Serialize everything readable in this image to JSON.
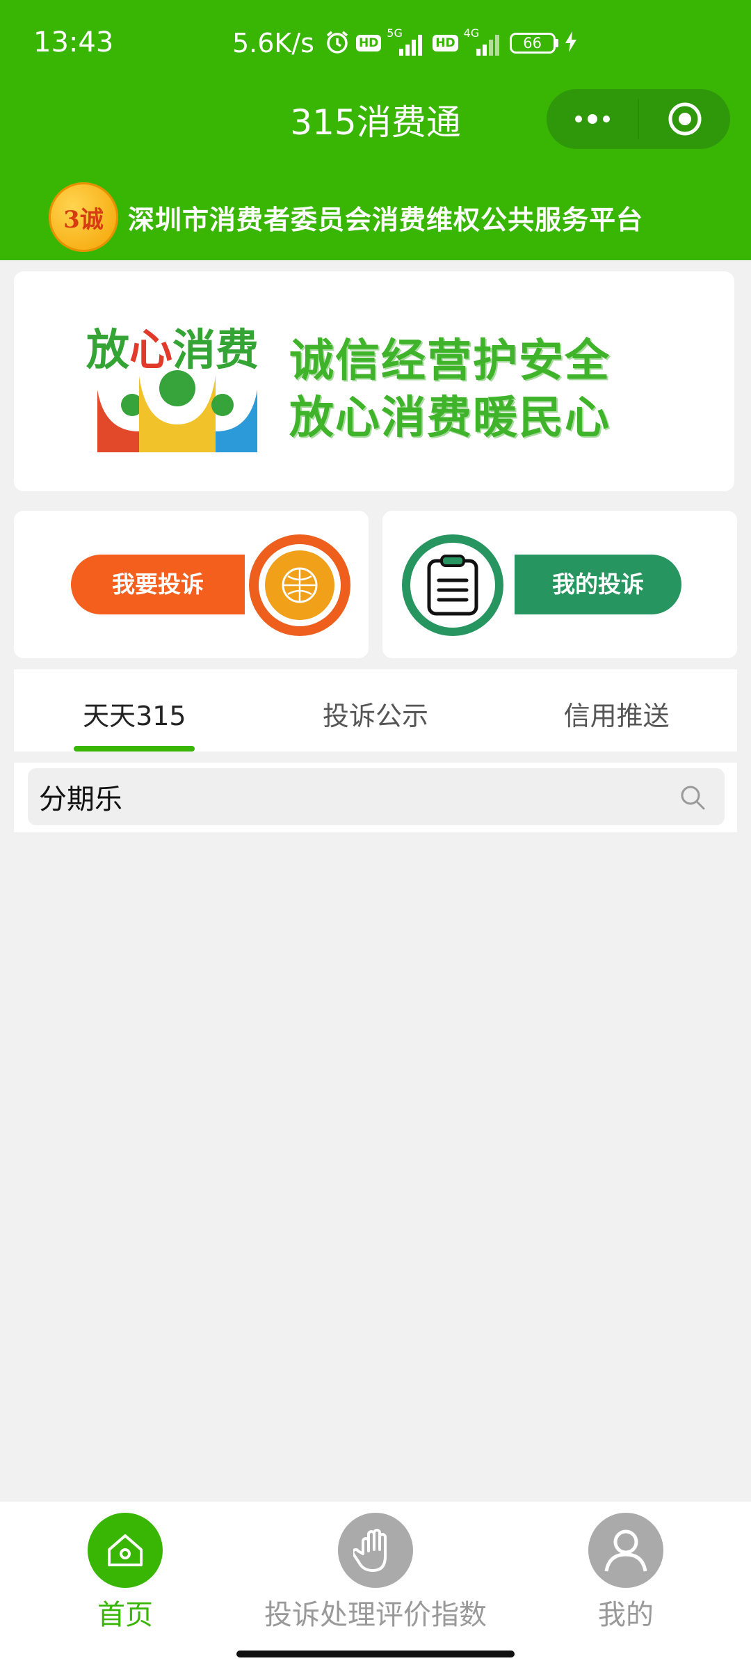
{
  "status_bar": {
    "time": "13:43",
    "speed": "5.6K/s",
    "hd1": "HD",
    "net1": "5G",
    "hd2": "HD",
    "net2": "4G",
    "battery": "66"
  },
  "nav": {
    "title": "315消费通"
  },
  "platform": {
    "logo_text": "3诚",
    "name": "深圳市消费者委员会消费维权公共服务平台"
  },
  "banner": {
    "slogan_prefix": "放",
    "slogan_red": "心",
    "slogan_suffix": "消费",
    "slogan_line1": "诚信经营护安全",
    "slogan_line2": "放心消费暖民心"
  },
  "actions": {
    "complain_label": "我要投诉",
    "my_complaints_label": "我的投诉"
  },
  "tabs": [
    {
      "label": "天天315"
    },
    {
      "label": "投诉公示"
    },
    {
      "label": "信用推送"
    }
  ],
  "search": {
    "value": "分期乐"
  },
  "tabbar": [
    {
      "label": "首页",
      "icon": "home-icon"
    },
    {
      "label": "投诉处理评价指数",
      "icon": "hand-icon"
    },
    {
      "label": "我的",
      "icon": "user-icon"
    }
  ],
  "colors": {
    "brand_green": "#39b504",
    "accent_orange": "#f55f1d",
    "accent_dark_green": "#27955f"
  }
}
